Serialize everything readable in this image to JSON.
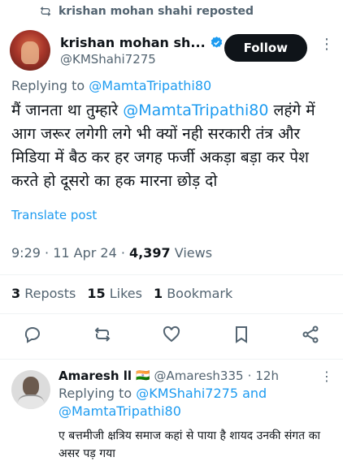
{
  "repost": {
    "text": "krishan mohan shahi reposted",
    "icon": "repost-icon"
  },
  "author": {
    "name": "krishan mohan sh...",
    "handle": "@KMShahi7275",
    "verified": true,
    "follow_label": "Follow"
  },
  "replying": {
    "prefix": "Replying to",
    "handle": "@MamtaTripathi80"
  },
  "tweet": {
    "text_before": "मैं जानता था तुम्हारे ",
    "mention": "@MamtaTripathi80",
    "text_after": " लहंगे में आग जरूर लगेगी लगे भी क्यों नही सरकारी तंत्र और मिडिया में बैठ कर हर जगह फर्जी अकड़ा बड़ा कर पेश करते हो दूसरो का हक मारना छोड़ दो",
    "translate_label": "Translate post"
  },
  "meta": {
    "time": "9:29",
    "date": "11 Apr 24",
    "views_count": "4,397",
    "views_label": "Views"
  },
  "stats": {
    "reposts_count": "3",
    "reposts_label": "Reposts",
    "likes_count": "15",
    "likes_label": "Likes",
    "bookmarks_count": "1",
    "bookmarks_label": "Bookmark"
  },
  "actions": [
    "reply-icon",
    "repost-icon",
    "like-icon",
    "bookmark-icon",
    "share-icon"
  ],
  "reply": {
    "name": "Amaresh ll",
    "flag": "🇮🇳",
    "handle": "@Amaresh335",
    "time": "12h",
    "replying_prefix": "Replying to",
    "replying_handle1": "@KMShahi7275",
    "replying_and": "and",
    "replying_handle2": "@MamtaTripathi80",
    "text": "ए बत्तमीजी क्षत्रिय समाज कहां से पाया है शायद उनकी संगत का असर पड़ गया"
  },
  "colors": {
    "accent": "#1d9bf0",
    "muted": "#536471",
    "text": "#0f1419"
  }
}
